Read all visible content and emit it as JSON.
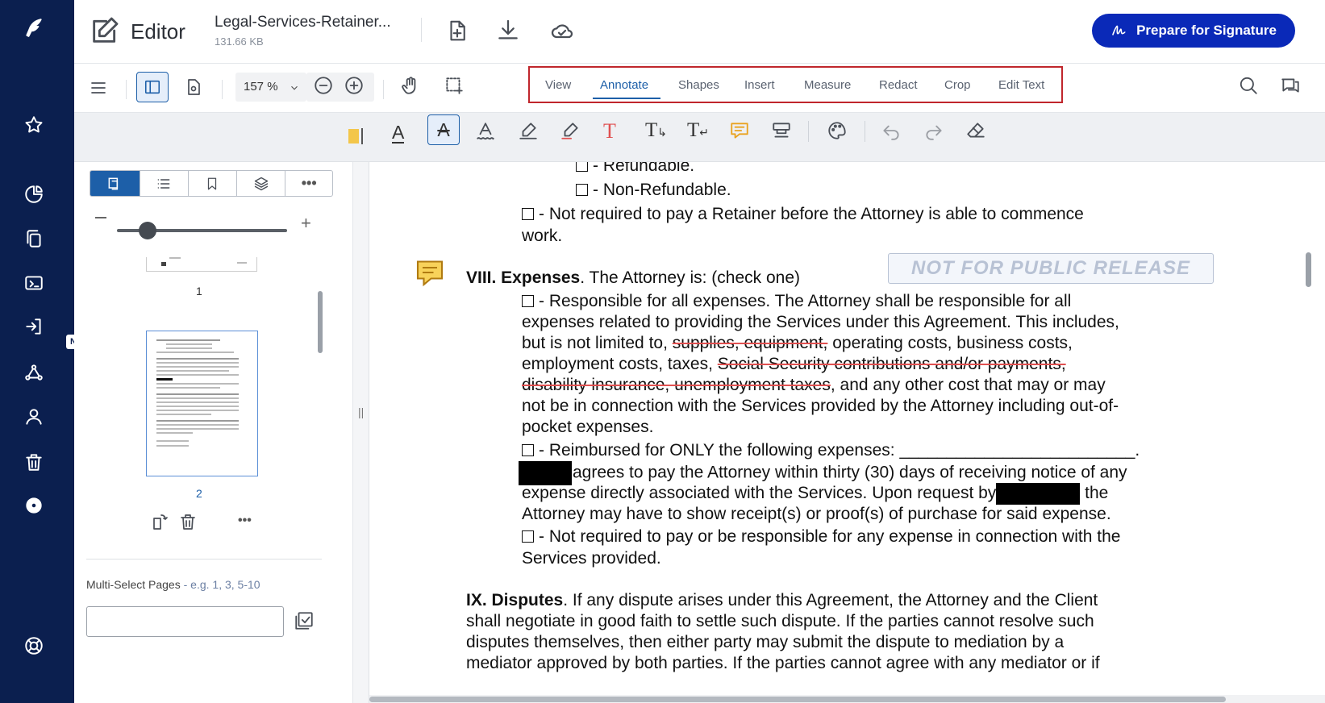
{
  "app": {
    "name": "Editor",
    "file_name": "Legal-Services-Retainer...",
    "file_size": "131.66 KB",
    "primary_button": "Prepare for Signature",
    "new_badge": "NEW"
  },
  "toolbar": {
    "zoom": "157 %",
    "tabs": [
      "View",
      "Annotate",
      "Shapes",
      "Insert",
      "Measure",
      "Redact",
      "Crop",
      "Edit Text"
    ],
    "active_tab": "Annotate"
  },
  "sidebar": {
    "page_labels": [
      "1",
      "2"
    ],
    "multi_select_label": "Multi-Select Pages",
    "multi_select_hint": "- e.g. 1, 3, 5-10",
    "multi_select_value": ""
  },
  "document": {
    "stamp": "NOT FOR PUBLIC RELEASE",
    "opt_refundable": "- Refundable.",
    "opt_nonrefundable": "- Non-Refundable.",
    "retainer_line1": "- Not required to pay a Retainer before the Attorney is able to commence",
    "retainer_line2": "work.",
    "exp_heading": "VIII. Expenses",
    "exp_heading_rest": ". The Attorney is: (check one)",
    "exp1_l1": "- Responsible for all expenses. The Attorney shall be responsible for all",
    "exp1_l2": "expenses related to providing the Services under this Agreement. This includes,",
    "exp1_l3a": "but is not limited to, ",
    "exp1_l3s": "supplies, equipment,",
    "exp1_l3b": " operating costs, business costs,",
    "exp1_l4a": "employment costs, taxes, ",
    "exp1_l4s": "Social Security contributions and/or payments,",
    "exp1_l5s": "disability insurance, unemployment taxes",
    "exp1_l5b": ", and any other cost that may or may",
    "exp1_l6": "not be in connection with the Services provided by the Attorney including out-of-",
    "exp1_l7": "pocket expenses.",
    "exp2_l1": "- Reimbursed for ONLY the following expenses: _________________________.",
    "exp2_l2": "agrees to pay the Attorney within thirty (30) days of receiving notice of any",
    "exp2_l3a": "expense directly associated with the Services. Upon request by",
    "exp2_l3b": " the",
    "exp2_l4": "Attorney may have to show receipt(s) or proof(s) of purchase for said expense.",
    "exp3_l1": "- Not required to pay or be responsible for any expense in connection with the",
    "exp3_l2": "Services provided.",
    "disp_heading": "IX. Disputes",
    "disp_l1": ". If any dispute arises under this Agreement, the Attorney and the Client",
    "disp_l2": "shall negotiate in good faith to settle such dispute. If the parties cannot resolve such",
    "disp_l3": "disputes themselves, then either party may submit the dispute to mediation by a",
    "disp_l4": "mediator approved by both parties. If the parties cannot agree with any mediator or if"
  },
  "colors": {
    "rail": "#0b1f4f",
    "primary": "#0a29b8",
    "active_tab": "#1d5fa8",
    "tab_outline": "#c0262c",
    "strike": "#e05050"
  }
}
